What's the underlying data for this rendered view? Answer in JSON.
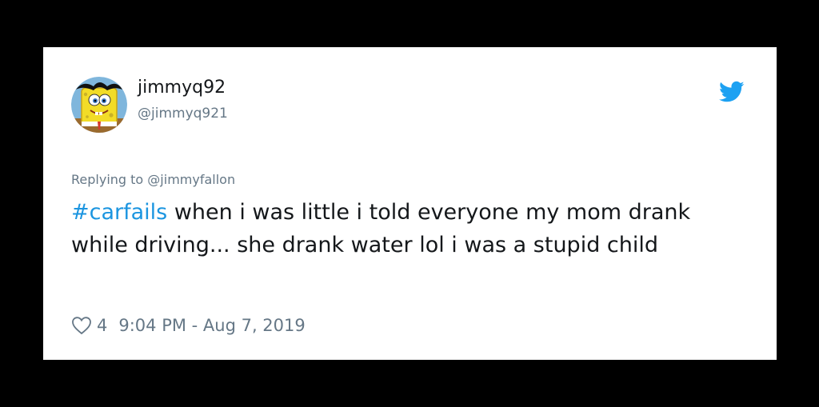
{
  "tweet": {
    "display_name": "jimmyq92",
    "handle": "@jimmyq921",
    "replying_to_prefix": "Replying to ",
    "replying_to_mention": "@jimmyfallon",
    "hashtag": "#carfails",
    "body": " when i was little i told everyone my mom drank while driving... she drank water lol i was a stupid child",
    "like_count": "4",
    "timestamp": "9:04 PM - Aug 7, 2019"
  },
  "icons": {
    "brand": "twitter-bird-icon",
    "like": "heart-icon",
    "avatar": "spongebob-avatar"
  },
  "colors": {
    "background": "#000000",
    "card": "#ffffff",
    "text": "#14171a",
    "muted": "#657786",
    "accent": "#1b95e0",
    "twitter_blue": "#1da1f2"
  }
}
